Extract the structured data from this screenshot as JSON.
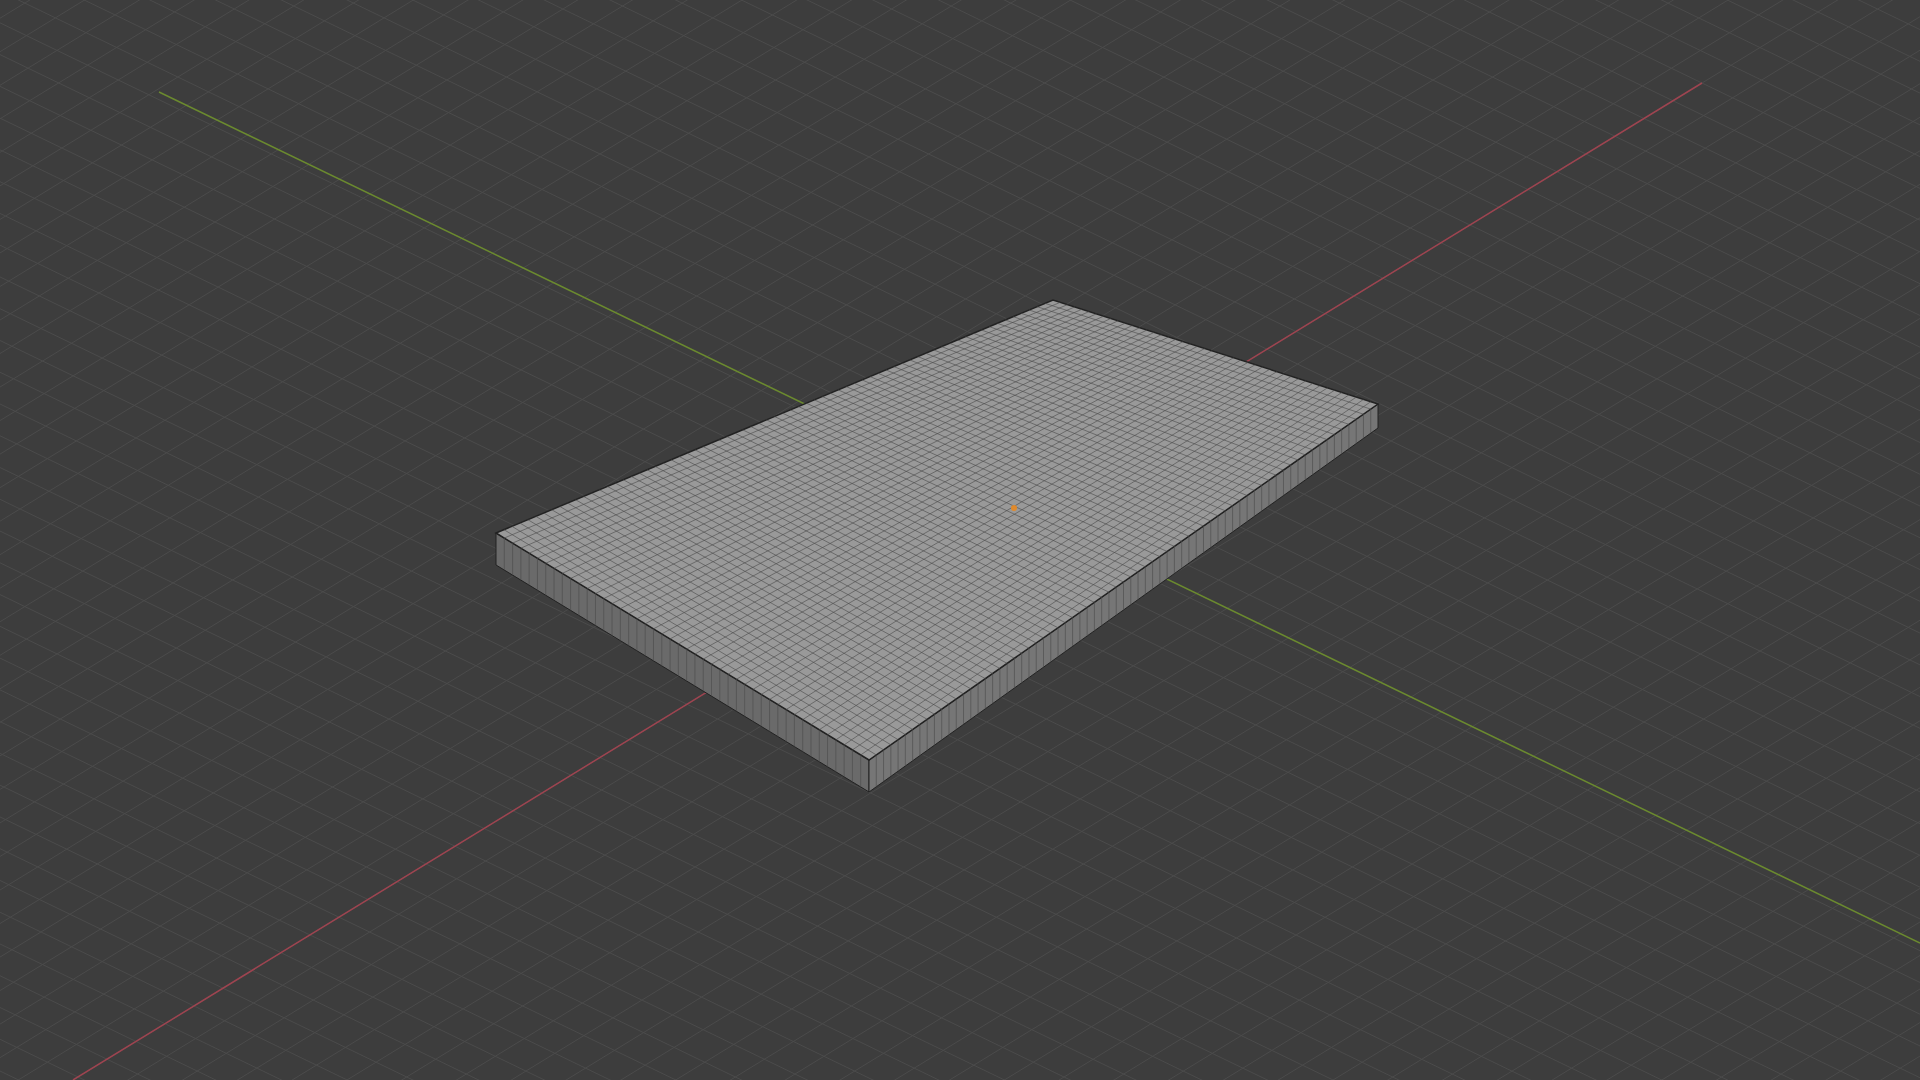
{
  "viewport": {
    "axes": [
      {
        "kind": "x",
        "color": "#9e4450"
      },
      {
        "kind": "y",
        "color": "#6b8a2f"
      }
    ]
  }
}
